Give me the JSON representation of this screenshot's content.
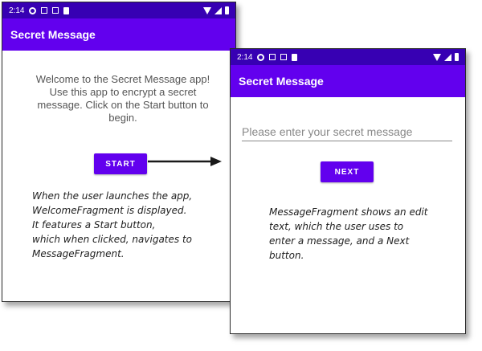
{
  "colors": {
    "primary": "#6200ee",
    "status_bar": "#3700b3",
    "button": "#6200ee"
  },
  "left_screen": {
    "status_bar": {
      "time": "2:14",
      "icons": [
        "settings-icon",
        "play-protect-icon",
        "notification-icon",
        "sd-card-icon",
        "wifi-icon",
        "signal-icon",
        "battery-icon"
      ]
    },
    "app_bar_title": "Secret Message",
    "welcome_text": "Welcome to the Secret Message app! Use this app to encrypt a secret message. Click on the Start button to begin.",
    "start_button_label": "START",
    "annotation": "When the user launches the app,\nWelcomeFragment is displayed.\nIt features a Start button,\nwhich when clicked, navigates to\nMessageFragment."
  },
  "right_screen": {
    "status_bar": {
      "time": "2:14",
      "icons": [
        "settings-icon",
        "play-protect-icon",
        "notification-icon",
        "sd-card-icon",
        "wifi-icon",
        "signal-icon",
        "battery-icon"
      ]
    },
    "app_bar_title": "Secret Message",
    "message_input": {
      "value": "",
      "placeholder": "Please enter your secret message"
    },
    "next_button_label": "NEXT",
    "annotation": "MessageFragment shows an edit\ntext, which the user uses to\nenter a message, and a Next\nbutton."
  }
}
